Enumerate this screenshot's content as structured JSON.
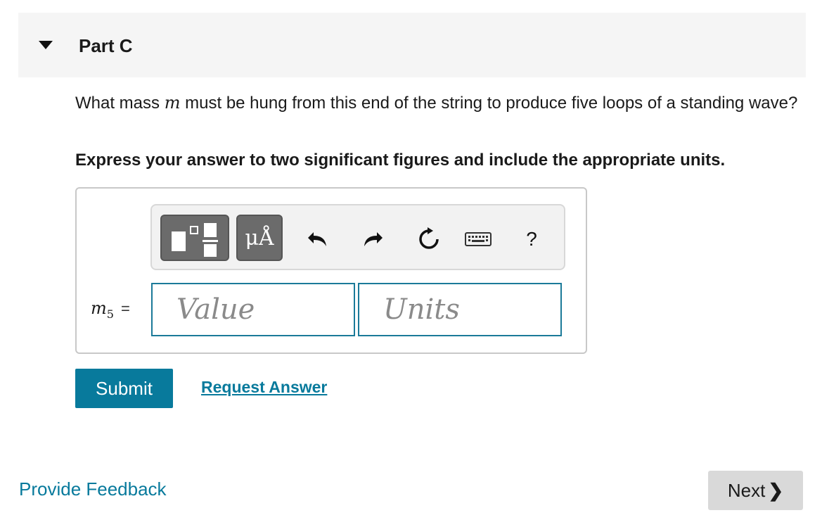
{
  "part": {
    "title": "Part C"
  },
  "question": {
    "before": "What mass ",
    "variable": "m",
    "after": " must be hung from this end of the string to produce five loops of a standing wave?"
  },
  "instruction": "Express your answer to two significant figures and include the appropriate units.",
  "toolbar": {
    "units_label": "μÅ",
    "help_label": "?",
    "icons": [
      "templates-icon",
      "units-icon",
      "undo-icon",
      "redo-icon",
      "reset-icon",
      "keyboard-icon",
      "help-icon"
    ]
  },
  "equation": {
    "variable": "m",
    "subscript": "5",
    "sign": "="
  },
  "inputs": {
    "value_placeholder": "Value",
    "units_placeholder": "Units"
  },
  "actions": {
    "submit_label": "Submit",
    "request_label": "Request Answer",
    "feedback_label": "Provide Feedback",
    "next_label": "Next",
    "next_chevron": "❯"
  },
  "colors": {
    "accent": "#087a9c",
    "header_bg": "#f5f5f5",
    "input_border": "#1b7a99"
  }
}
